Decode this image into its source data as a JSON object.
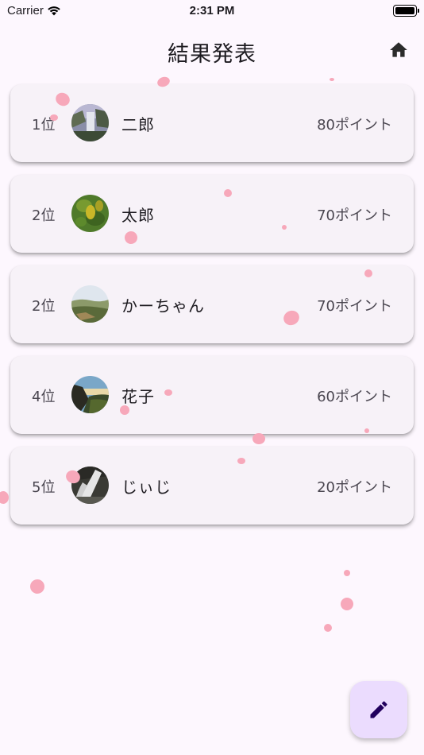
{
  "status_bar": {
    "carrier": "Carrier",
    "time": "2:31 PM"
  },
  "header": {
    "title": "結果発表",
    "home_icon": "home-icon"
  },
  "ranking": [
    {
      "rank": "1位",
      "name": "二郎",
      "points": "80ポイント",
      "avatar": "waterfall-photo"
    },
    {
      "rank": "2位",
      "name": "太郎",
      "points": "70ポイント",
      "avatar": "green-fruit-photo"
    },
    {
      "rank": "2位",
      "name": "かーちゃん",
      "points": "70ポイント",
      "avatar": "hill-landscape-photo"
    },
    {
      "rank": "4位",
      "name": "花子",
      "points": "60ポイント",
      "avatar": "cliff-sunset-photo"
    },
    {
      "rank": "5位",
      "name": "じぃじ",
      "points": "20ポイント",
      "avatar": "cascade-photo"
    }
  ],
  "fab": {
    "icon": "edit-pencil-icon"
  },
  "colors": {
    "background": "#fdf7fe",
    "card": "#f7f2f8",
    "petal": "#f7a8ba",
    "fab": "#ebdcfe",
    "fab_icon": "#21005d"
  }
}
